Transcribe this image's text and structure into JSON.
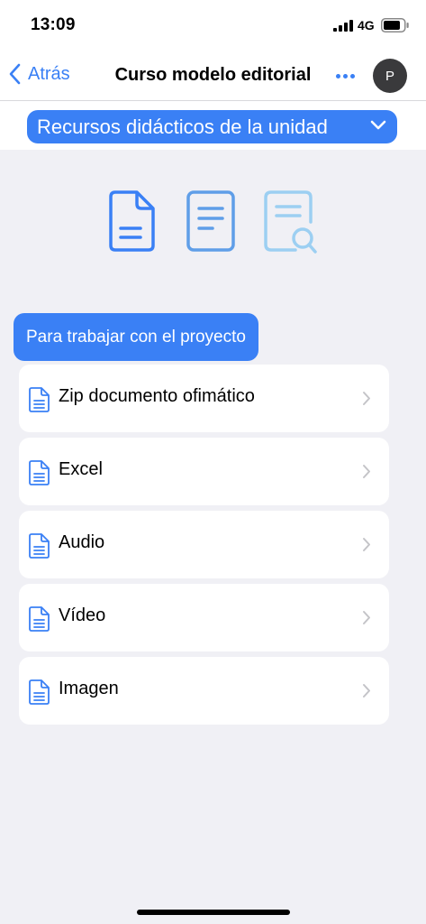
{
  "status": {
    "time": "13:09",
    "network": "4G"
  },
  "nav": {
    "back_label": "Atrás",
    "title": "Curso modelo editorial",
    "avatar_initial": "P"
  },
  "selector": {
    "label": "Recursos didácticos de la unidad"
  },
  "section": {
    "label": "Para trabajar con el proyecto"
  },
  "items": [
    {
      "label": "Zip documento ofimático"
    },
    {
      "label": "Excel"
    },
    {
      "label": "Audio"
    },
    {
      "label": "Vídeo"
    },
    {
      "label": "Imagen"
    }
  ],
  "colors": {
    "accent": "#3a80f5",
    "icon_mid": "#5f9ee8",
    "icon_light": "#9ccff2",
    "background": "#f0f0f5"
  },
  "icons": {
    "top_row": [
      "document-icon",
      "document-lines-icon",
      "document-search-icon"
    ],
    "row_icon": "document-icon",
    "row_chevron": "chevron-right-icon"
  }
}
